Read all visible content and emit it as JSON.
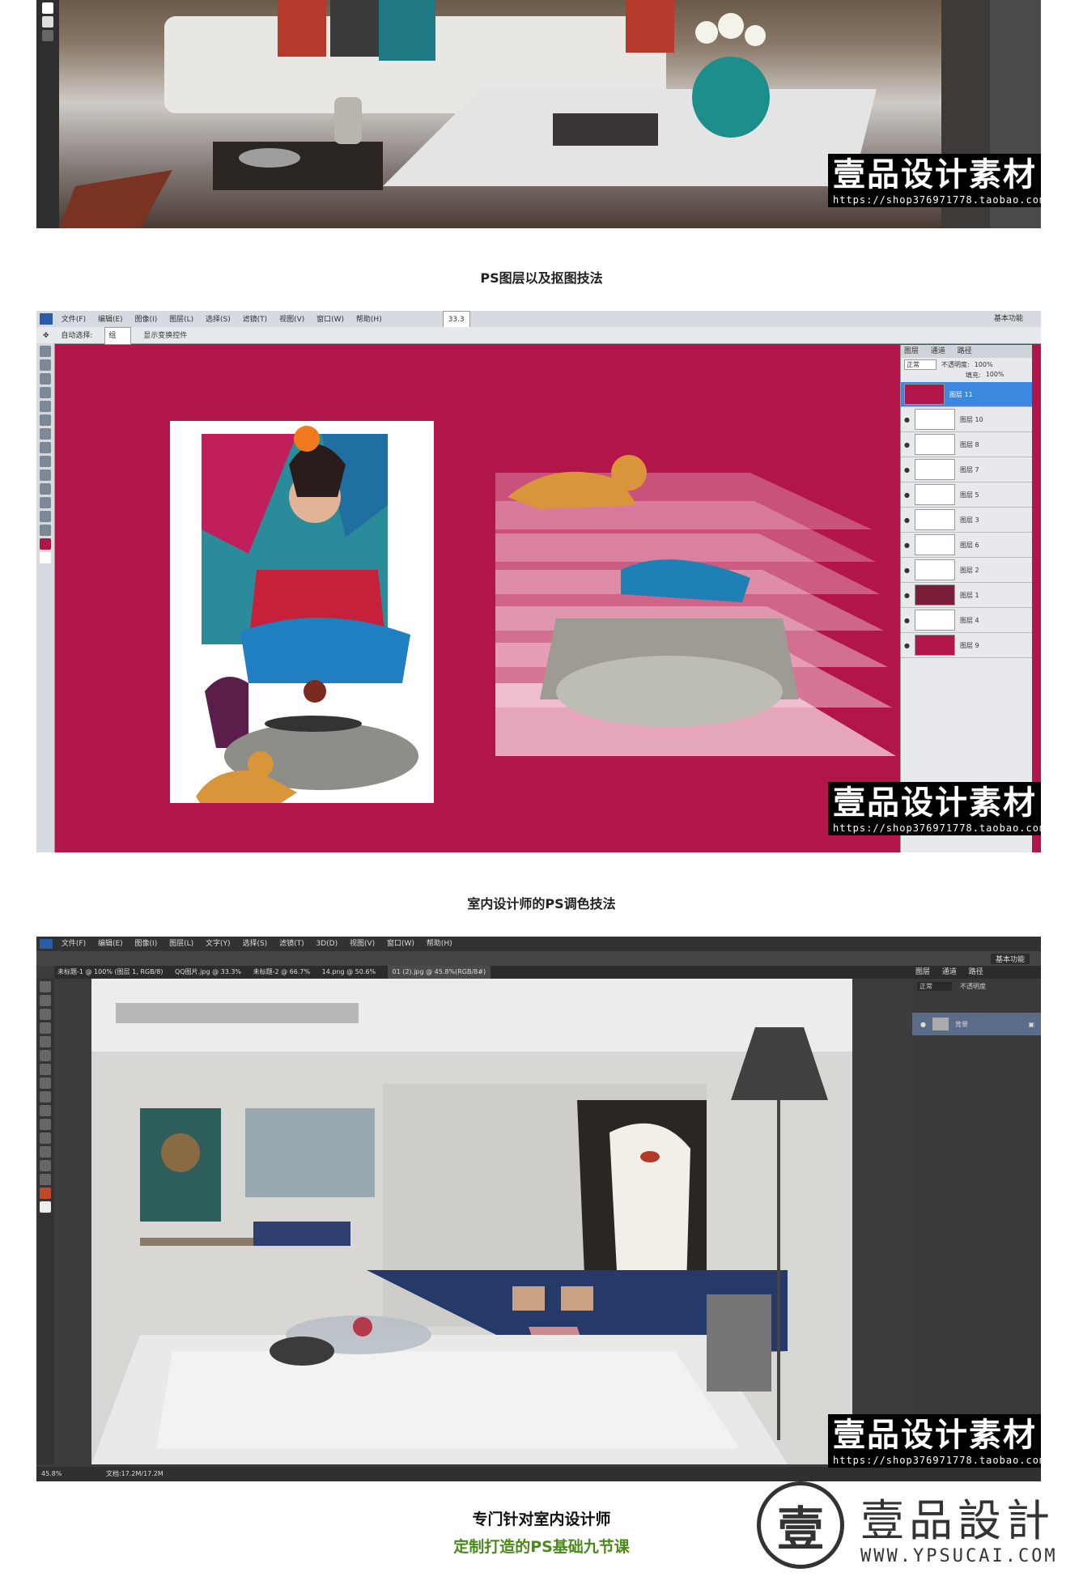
{
  "captions": {
    "section2": "PS图层以及抠图技法",
    "section3": "室内设计师的PS调色技法",
    "bottom_line1": "专门针对室内设计师",
    "bottom_line2": "定制打造的PS基础九节课"
  },
  "watermark": {
    "brand": "壹品设计素材",
    "url": "https://shop376971778.taobao.com"
  },
  "brand_logo": {
    "seal_char": "壹",
    "name": "壹品設計",
    "site": "WWW.YPSUCAI.COM"
  },
  "ps_window_2": {
    "menu": [
      "文件(F)",
      "编辑(E)",
      "图像(I)",
      "图层(L)",
      "选择(S)",
      "滤镜(T)",
      "视图(V)",
      "窗口(W)",
      "帮助(H)"
    ],
    "zoom": "33.3",
    "workspace": "基本功能",
    "option_auto_select": "自动选择:",
    "option_group": "组",
    "option_transform": "显示变换控件",
    "layers_tabs": [
      "图层",
      "通道",
      "路径"
    ],
    "blend_mode": "正常",
    "opacity_label": "不透明度:",
    "opacity": "100%",
    "fill_label": "填充:",
    "fill": "100%",
    "layers": [
      "图层 11",
      "图层 10",
      "图层 8",
      "图层 7",
      "图层 5",
      "图层 3",
      "图层 6",
      "图层 2",
      "图层 1",
      "图层 4",
      "图层 9"
    ]
  },
  "ps_window_3": {
    "menu": [
      "文件(F)",
      "编辑(E)",
      "图像(I)",
      "图层(L)",
      "文字(Y)",
      "选择(S)",
      "滤镜(T)",
      "3D(D)",
      "视图(V)",
      "窗口(W)",
      "帮助(H)"
    ],
    "workspace": "基本功能",
    "tabs": [
      "未标题-1 @ 100% (图层 1, RGB/8)",
      "QQ图片.jpg @ 33.3%",
      "未标题-2 @ 66.7%",
      "14.png @ 50.6%",
      "01 (2).jpg @ 45.8%(RGB/8#)"
    ],
    "zoom_status": "45.8%",
    "doc_status": "文档:17.2M/17.2M",
    "layers_tabs": [
      "图层",
      "通道",
      "路径"
    ],
    "blend_mode": "正常",
    "opacity": "不透明度",
    "layer_name": "背景"
  },
  "colors": {
    "crimson": "#b1154a",
    "ps_dark": "#3c3c3c",
    "ps_light": "#e8e8e8",
    "caption_green": "#4a8a1a"
  }
}
